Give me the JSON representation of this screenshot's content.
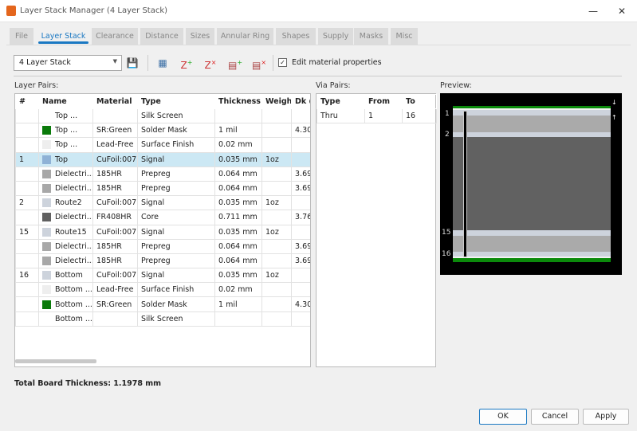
{
  "window": {
    "title": "Layer Stack Manager (4 Layer Stack)",
    "minimize": "—",
    "maximize": "☐",
    "close": "✕"
  },
  "tabs": [
    {
      "label": "File"
    },
    {
      "label": "Layer Stack",
      "active": true
    },
    {
      "label": "Clearance"
    },
    {
      "label": "Distance"
    },
    {
      "label": "Sizes"
    },
    {
      "label": "Annular Ring"
    },
    {
      "label": "Shapes"
    },
    {
      "label": "Supply"
    },
    {
      "label": "Masks"
    },
    {
      "label": "Misc"
    }
  ],
  "toolbar": {
    "stack_select": "4 Layer Stack",
    "edit_material_label": "Edit material properties",
    "edit_material_checked": true
  },
  "layer_pairs": {
    "label": "Layer Pairs:",
    "columns": [
      "#",
      "Name",
      "Material",
      "Type",
      "Thickness",
      "Weight",
      "Dk @"
    ],
    "rows": [
      {
        "num": "",
        "name": "Top ...",
        "color": "",
        "material": "",
        "type": "Silk Screen",
        "thickness": "",
        "weight": "",
        "dk": ""
      },
      {
        "num": "",
        "name": "Top ...",
        "color": "#0a7a0a",
        "material": "SR:Green",
        "type": "Solder Mask",
        "thickness": "1 mil",
        "weight": "",
        "dk": "4.30"
      },
      {
        "num": "",
        "name": "Top ...",
        "color": "#eeeeee",
        "material": "Lead-Free",
        "type": "Surface Finish",
        "thickness": "0.02 mm",
        "weight": "",
        "dk": ""
      },
      {
        "num": "1",
        "name": "Top",
        "color": "#8fb2d6",
        "material": "CuFoil:007",
        "type": "Signal",
        "thickness": "0.035 mm",
        "weight": "1oz",
        "dk": "",
        "selected": true
      },
      {
        "num": "",
        "name": "Dielectri...",
        "color": "#a8a8a8",
        "material": "185HR",
        "type": "Prepreg",
        "thickness": "0.064 mm",
        "weight": "",
        "dk": "3.69"
      },
      {
        "num": "",
        "name": "Dielectri...",
        "color": "#a8a8a8",
        "material": "185HR",
        "type": "Prepreg",
        "thickness": "0.064 mm",
        "weight": "",
        "dk": "3.69"
      },
      {
        "num": "2",
        "name": "Route2",
        "color": "#cdd3dc",
        "material": "CuFoil:007",
        "type": "Signal",
        "thickness": "0.035 mm",
        "weight": "1oz",
        "dk": ""
      },
      {
        "num": "",
        "name": "Dielectri...",
        "color": "#606060",
        "material": "FR408HR",
        "type": "Core",
        "thickness": "0.711 mm",
        "weight": "",
        "dk": "3.76"
      },
      {
        "num": "15",
        "name": "Route15",
        "color": "#cdd3dc",
        "material": "CuFoil:007",
        "type": "Signal",
        "thickness": "0.035 mm",
        "weight": "1oz",
        "dk": ""
      },
      {
        "num": "",
        "name": "Dielectri...",
        "color": "#a8a8a8",
        "material": "185HR",
        "type": "Prepreg",
        "thickness": "0.064 mm",
        "weight": "",
        "dk": "3.69"
      },
      {
        "num": "",
        "name": "Dielectri...",
        "color": "#a8a8a8",
        "material": "185HR",
        "type": "Prepreg",
        "thickness": "0.064 mm",
        "weight": "",
        "dk": "3.69"
      },
      {
        "num": "16",
        "name": "Bottom",
        "color": "#cdd3dc",
        "material": "CuFoil:007",
        "type": "Signal",
        "thickness": "0.035 mm",
        "weight": "1oz",
        "dk": ""
      },
      {
        "num": "",
        "name": "Bottom ...",
        "color": "#eeeeee",
        "material": "Lead-Free",
        "type": "Surface Finish",
        "thickness": "0.02 mm",
        "weight": "",
        "dk": ""
      },
      {
        "num": "",
        "name": "Bottom ...",
        "color": "#0a7a0a",
        "material": "SR:Green",
        "type": "Solder Mask",
        "thickness": "1 mil",
        "weight": "",
        "dk": "4.30"
      },
      {
        "num": "",
        "name": "Bottom ...",
        "color": "",
        "material": "",
        "type": "Silk Screen",
        "thickness": "",
        "weight": "",
        "dk": ""
      }
    ]
  },
  "via_pairs": {
    "label": "Via Pairs:",
    "columns": [
      "Type",
      "From",
      "To"
    ],
    "rows": [
      {
        "type": "Thru",
        "from": "1",
        "to": "16"
      }
    ]
  },
  "preview": {
    "label": "Preview:",
    "layer_labels": [
      "1",
      "2",
      "15",
      "16"
    ]
  },
  "total_thickness": "Total Board Thickness: 1.1978 mm",
  "buttons": {
    "ok": "OK",
    "cancel": "Cancel",
    "apply": "Apply"
  }
}
